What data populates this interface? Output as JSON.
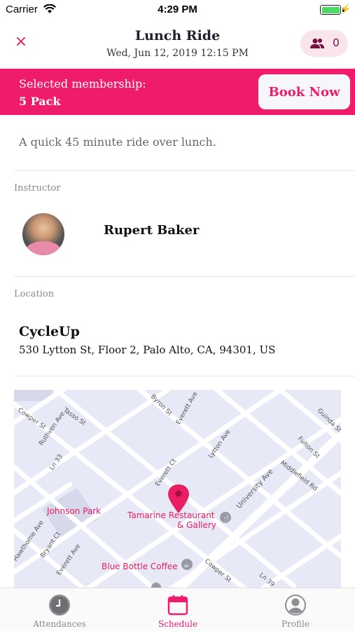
{
  "status": {
    "carrier": "Carrier",
    "time": "4:29 PM",
    "battery_level": 1.0
  },
  "header": {
    "title": "Lunch Ride",
    "datetime": "Wed, Jun 12, 2019 12:15 PM",
    "close_icon": "×",
    "attendee_count": "0"
  },
  "banner": {
    "label": "Selected membership:",
    "value": "5 Pack",
    "book_label": "Book Now"
  },
  "description": "A quick 45 minute ride over lunch.",
  "instructor": {
    "section_label": "Instructor",
    "name": "Rupert Baker"
  },
  "location": {
    "section_label": "Location",
    "name": "CycleUp",
    "address": "530 Lytton St, Floor 2, Palo Alto, CA, 94301, US"
  },
  "map": {
    "streets": [
      "Cowper St",
      "Tasso St",
      "Byron St",
      "Everett Ave",
      "Ruthven Ave",
      "Ln 33",
      "Lytton Ave",
      "Guinda St",
      "Fulton St",
      "Middlefield Rd",
      "University Ave",
      "Everett Ct",
      "Hawthorne Ave",
      "Bryant Ct",
      "Everett Ave",
      "Cowper St",
      "Ln 39"
    ],
    "places": [
      "Johnson Park",
      "Tamarine Restaurant",
      "& Gallery",
      "Blue Bottle Coffee"
    ],
    "pin_color": "#e91e63"
  },
  "tabs": [
    {
      "label": "Attendances",
      "icon": "clock-icon"
    },
    {
      "label": "Schedule",
      "icon": "calendar-icon"
    },
    {
      "label": "Profile",
      "icon": "profile-icon"
    }
  ],
  "colors": {
    "accent": "#ee1c6a",
    "accent_light": "#fbe5ec"
  }
}
